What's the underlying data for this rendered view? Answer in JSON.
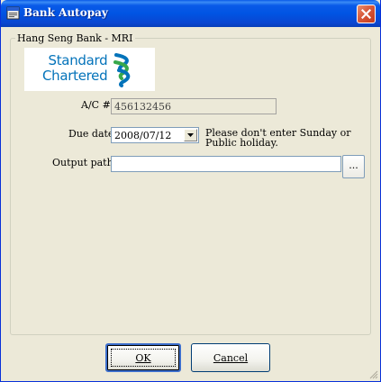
{
  "window": {
    "title": "Bank Autopay"
  },
  "group": {
    "label": "Hang Seng Bank - MRI"
  },
  "logo": {
    "line1": "Standard",
    "line2": "Chartered"
  },
  "form": {
    "account_label": "A/C #",
    "account_value": "456132456",
    "due_date_label": "Due date",
    "due_date_value": "2008/07/12",
    "due_date_hint": "Please don't enter Sunday or Public holiday.",
    "output_path_label": "Output path:",
    "output_path_value": "",
    "browse_label": "..."
  },
  "buttons": {
    "ok_label": "OK",
    "cancel_label": "Cancel"
  },
  "colors": {
    "titlebar": "#0054e3",
    "window_bg": "#ece9d8",
    "logo_blue": "#0473ba",
    "logo_green": "#38a84c"
  }
}
